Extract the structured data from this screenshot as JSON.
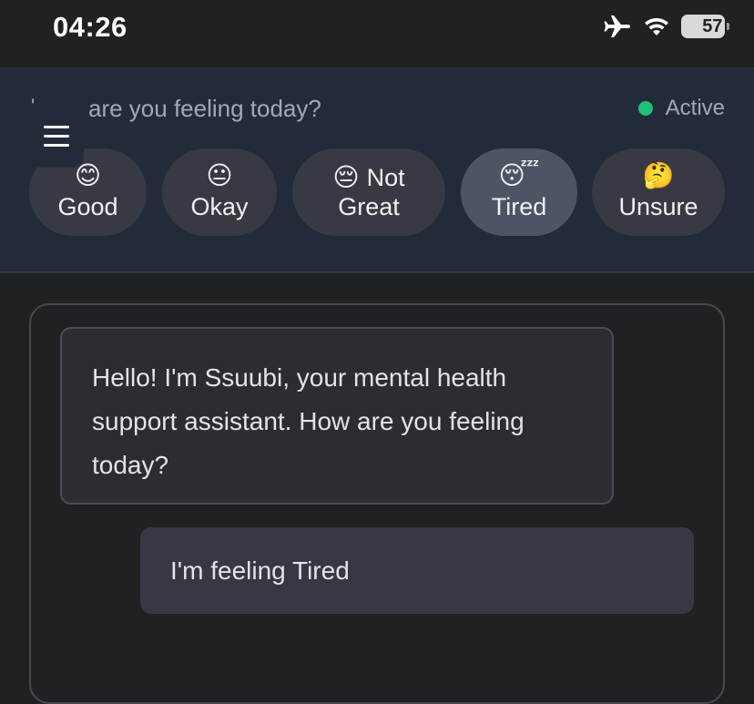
{
  "status_bar": {
    "time": "04:26",
    "battery_level": "57",
    "battery_fraction": 0.57,
    "icons": [
      "airplane-icon",
      "wifi-icon",
      "battery-icon"
    ]
  },
  "mood_panel": {
    "question_prefix": "'",
    "question": "are you feeling today?",
    "status_label": "Active",
    "status_color": "#1fbf7a",
    "moods": [
      {
        "emoji": "😊",
        "label": "Good",
        "selected": false
      },
      {
        "emoji": "😐",
        "label": "Okay",
        "selected": false
      },
      {
        "emoji": "😔",
        "label_line1": "Not",
        "label_line2": "Great",
        "selected": false
      },
      {
        "emoji": "😴",
        "label": "Tired",
        "selected": true
      },
      {
        "emoji": "🤔",
        "label": "Unsure",
        "selected": false
      }
    ]
  },
  "chat": {
    "messages": [
      {
        "sender": "bot",
        "text": "Hello! I'm Ssuubi, your mental health support assistant. How are you feeling today?"
      },
      {
        "sender": "user",
        "text": "I'm feeling Tired"
      }
    ]
  },
  "colors": {
    "background": "#1f2123",
    "panel": "#222b3a",
    "chip": "#373a42",
    "chip_selected": "#4d5565"
  }
}
